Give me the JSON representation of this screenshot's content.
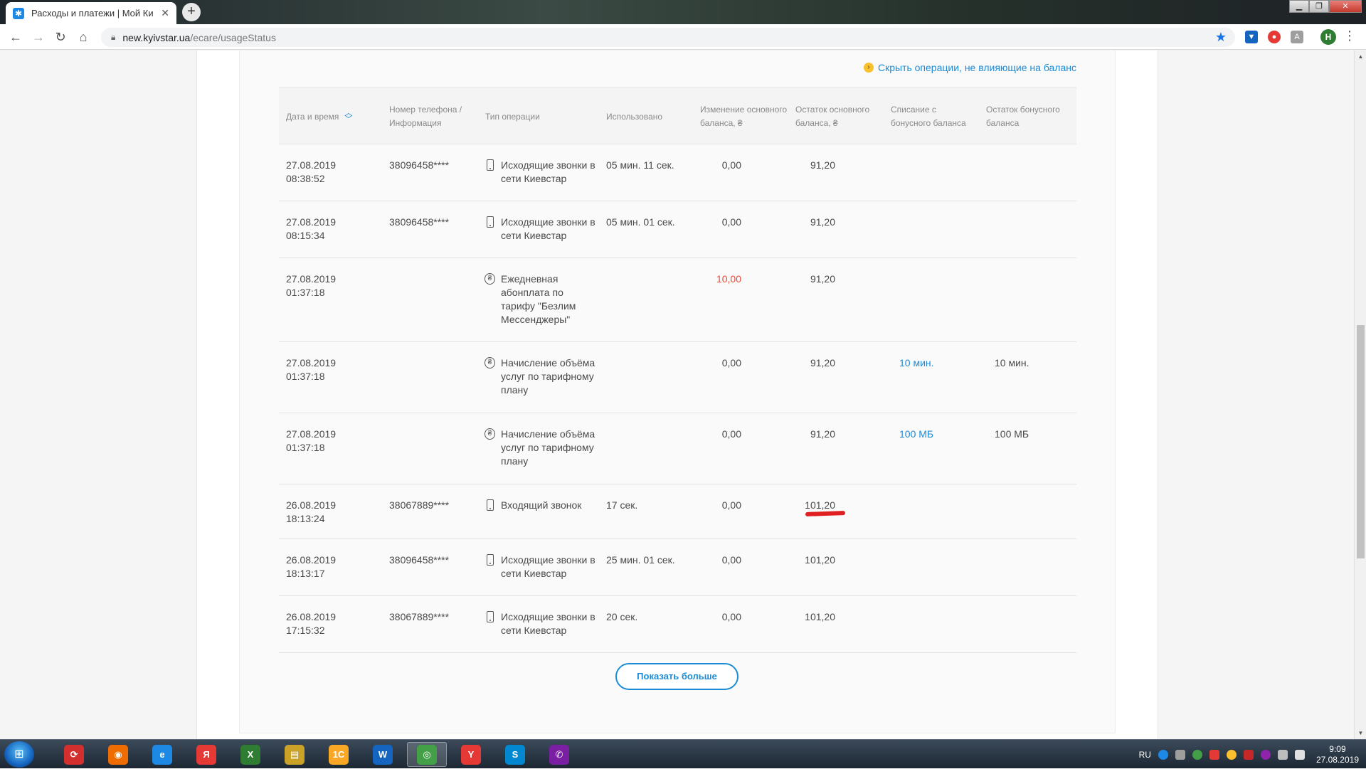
{
  "browser": {
    "tab_title": "Расходы и платежи | Мой Киевс",
    "url_domain": "new.kyivstar.ua",
    "url_path": "/ecare/usageStatus",
    "profile_initial": "H"
  },
  "page": {
    "filter_link": "Скрыть операции, не влияющие на баланс",
    "columns": {
      "date": "Дата и время",
      "phone": "Номер телефона / Информация",
      "type": "Тип операции",
      "used": "Использовано",
      "change": "Изменение основного баланса, ₴",
      "rest": "Остаток основного баланса, ₴",
      "bonus_writeoff": "Списание с бонусного баланса",
      "bonus_rest": "Остаток бонусного баланса"
    },
    "rows": [
      {
        "date": "27.08.2019",
        "time": "08:38:52",
        "phone": "38096458****",
        "icon": "phone-icon",
        "type": "Исходящие звонки в сети Киевстар",
        "used": "05 мин. 11 сек.",
        "change": "0,00",
        "rest": "91,20",
        "bonus_writeoff": "",
        "bonus_rest": ""
      },
      {
        "date": "27.08.2019",
        "time": "08:15:34",
        "phone": "38096458****",
        "icon": "phone-icon",
        "type": "Исходящие звонки в сети Киевстар",
        "used": "05 мин. 01 сек.",
        "change": "0,00",
        "rest": "91,20",
        "bonus_writeoff": "",
        "bonus_rest": ""
      },
      {
        "date": "27.08.2019",
        "time": "01:37:18",
        "phone": "",
        "icon": "coin-icon",
        "type": "Ежедневная абонплата по тарифу \"Безлим Мессенджеры\"",
        "used": "",
        "change": "10,00",
        "change_color": "red",
        "rest": "91,20",
        "bonus_writeoff": "",
        "bonus_rest": ""
      },
      {
        "date": "27.08.2019",
        "time": "01:37:18",
        "phone": "",
        "icon": "coin-icon",
        "type": "Начисление объёма услуг по тарифному плану",
        "used": "",
        "change": "0,00",
        "rest": "91,20",
        "bonus_writeoff": "10 мин.",
        "bonus_rest": "10 мин."
      },
      {
        "date": "27.08.2019",
        "time": "01:37:18",
        "phone": "",
        "icon": "coin-icon",
        "type": "Начисление объёма услуг по тарифному плану",
        "used": "",
        "change": "0,00",
        "rest": "91,20",
        "bonus_writeoff": "100 МБ",
        "bonus_rest": "100 МБ"
      },
      {
        "date": "26.08.2019",
        "time": "18:13:24",
        "phone": "38067889****",
        "icon": "phone-icon",
        "type": "Входящий звонок",
        "used": "17 сек.",
        "change": "0,00",
        "rest": "101,20",
        "highlight": true,
        "bonus_writeoff": "",
        "bonus_rest": ""
      },
      {
        "date": "26.08.2019",
        "time": "18:13:17",
        "phone": "38096458****",
        "icon": "phone-icon",
        "type": "Исходящие звонки в сети Киевстар",
        "used": "25 мин. 01 сек.",
        "change": "0,00",
        "rest": "101,20",
        "bonus_writeoff": "",
        "bonus_rest": ""
      },
      {
        "date": "26.08.2019",
        "time": "17:15:32",
        "phone": "38067889****",
        "icon": "phone-icon",
        "type": "Исходящие звонки в сети Киевстар",
        "used": "20 сек.",
        "change": "0,00",
        "rest": "101,20",
        "bonus_writeoff": "",
        "bonus_rest": ""
      }
    ],
    "show_more": "Показать больше"
  },
  "taskbar": {
    "lang": "RU",
    "time": "9:09",
    "date": "27.08.2019",
    "apps": [
      {
        "name": "start-search-app",
        "glyph": "⟳",
        "color": "#d32f2f"
      },
      {
        "name": "firefox-app",
        "glyph": "◉",
        "color": "#ef6c00"
      },
      {
        "name": "internet-explorer-app",
        "glyph": "e",
        "color": "#1e88e5"
      },
      {
        "name": "yandex-app",
        "glyph": "Я",
        "color": "#e53935"
      },
      {
        "name": "excel-app",
        "glyph": "X",
        "color": "#2e7d32"
      },
      {
        "name": "file-explorer-app",
        "glyph": "▤",
        "color": "#c9a227"
      },
      {
        "name": "1c-app",
        "glyph": "1С",
        "color": "#f9a825"
      },
      {
        "name": "word-app",
        "glyph": "W",
        "color": "#1565c0"
      },
      {
        "name": "chrome-app",
        "glyph": "◎",
        "color": "#43a047",
        "active": true
      },
      {
        "name": "yandex-browser-app",
        "glyph": "Y",
        "color": "#e53935"
      },
      {
        "name": "skype-app",
        "glyph": "S",
        "color": "#0288d1"
      },
      {
        "name": "viber-app",
        "glyph": "✆",
        "color": "#7b1fa2"
      }
    ]
  }
}
